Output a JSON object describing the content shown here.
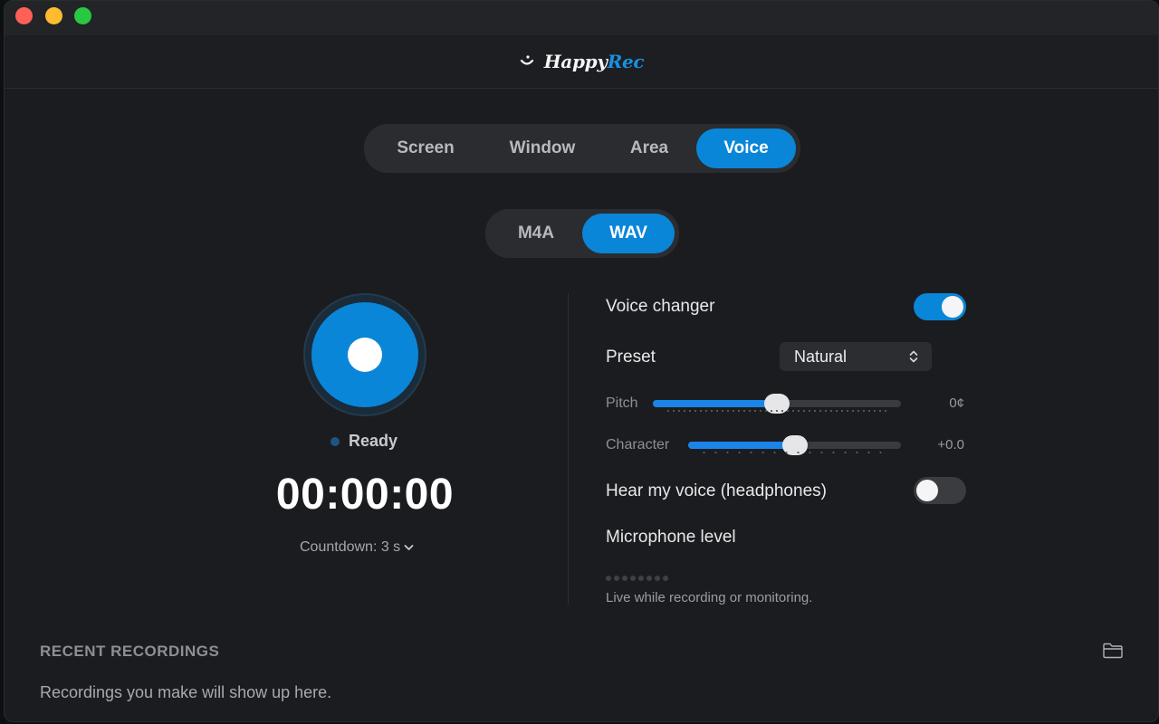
{
  "app": {
    "name_part1": "Happy",
    "name_part2": "Rec",
    "brand_color": "#0a86d8"
  },
  "modes": {
    "items": [
      "Screen",
      "Window",
      "Area",
      "Voice"
    ],
    "selected": "Voice"
  },
  "formats": {
    "items": [
      "M4A",
      "WAV"
    ],
    "selected": "WAV"
  },
  "recorder": {
    "status": "Ready",
    "timer": "00:00:00",
    "countdown": "Countdown: 3 s"
  },
  "voice": {
    "changer_label": "Voice changer",
    "changer_on": true,
    "preset_label": "Preset",
    "preset_value": "Natural",
    "pitch_label": "Pitch",
    "pitch_value": "0¢",
    "pitch_level": 0.5,
    "character_label": "Character",
    "character_value": "+0.0",
    "character_level": 0.5,
    "monitor_label": "Hear my voice (headphones)",
    "monitor_on": false,
    "mic_label": "Microphone level",
    "mic_hint": "Live while recording or monitoring."
  },
  "recent": {
    "title": "RECENT RECORDINGS",
    "empty": "Recordings you make will show up here."
  }
}
